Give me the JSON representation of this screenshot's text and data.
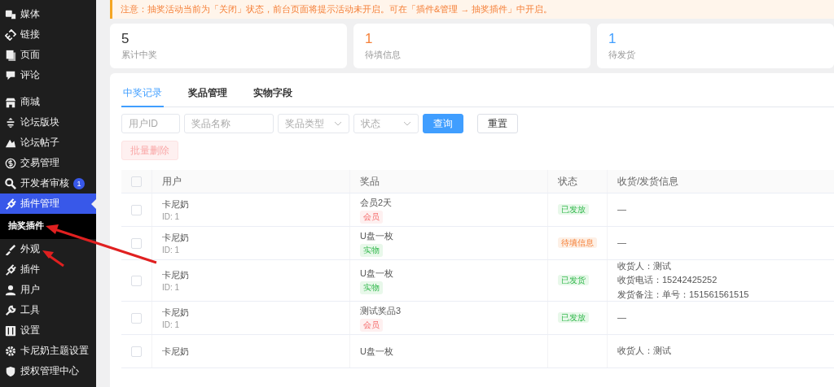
{
  "sidebar": {
    "groups": [
      {
        "items": [
          {
            "label": "媒体",
            "selected": false
          },
          {
            "label": "链接",
            "selected": false
          },
          {
            "label": "页面",
            "selected": false
          },
          {
            "label": "评论",
            "selected": false
          }
        ]
      },
      {
        "items": [
          {
            "label": "商城",
            "selected": false
          },
          {
            "label": "论坛版块",
            "selected": false
          },
          {
            "label": "论坛帖子",
            "selected": false
          },
          {
            "label": "交易管理",
            "selected": false
          },
          {
            "label": "开发者审核",
            "selected": false,
            "badge": "1"
          },
          {
            "label": "插件管理",
            "selected": true,
            "children": [
              {
                "label": "抽奖插件",
                "selected": true
              }
            ]
          },
          {
            "label": "外观",
            "selected": false
          },
          {
            "label": "插件",
            "selected": false
          },
          {
            "label": "用户",
            "selected": false
          },
          {
            "label": "工具",
            "selected": false
          },
          {
            "label": "设置",
            "selected": false
          },
          {
            "label": "卡尼奶主题设置",
            "selected": false
          },
          {
            "label": "授权管理中心",
            "selected": false
          }
        ]
      }
    ]
  },
  "notice": "注意：抽奖活动当前为「关闭」状态，前台页面将提示活动未开启。可在「插件&管理 → 抽奖插件」中开启。",
  "stats": [
    {
      "value": "5",
      "label": "累计中奖",
      "color": "#333333"
    },
    {
      "value": "1",
      "label": "待填信息",
      "color": "#f5813a"
    },
    {
      "value": "1",
      "label": "待发货",
      "color": "#409eff"
    }
  ],
  "tabs": [
    {
      "label": "中奖记录",
      "selected": true
    },
    {
      "label": "奖品管理",
      "selected": false
    },
    {
      "label": "实物字段",
      "selected": false
    }
  ],
  "filters": [
    {
      "kind": "input",
      "placeholder": "用户ID"
    },
    {
      "kind": "input",
      "placeholder": "奖品名称"
    },
    {
      "kind": "select",
      "placeholder": "奖品类型"
    },
    {
      "kind": "select",
      "placeholder": "状态"
    }
  ],
  "buttons": [
    {
      "kind": "primary",
      "label": "查询"
    },
    {
      "kind": "plain",
      "label": "重置"
    }
  ],
  "batch_delete": {
    "label": "批量删除",
    "disabled": true
  },
  "table": {
    "header_checked": false,
    "columns": [
      "用户",
      "奖品",
      "状态",
      "收货/发货信息"
    ],
    "rows": [
      {
        "checked": false,
        "user": "卡尼奶",
        "user_id": "ID: 1",
        "prize": "会员2天",
        "prize_tag": {
          "text": "会员",
          "kind": "member"
        },
        "status": {
          "text": "已发放",
          "kind": "done"
        },
        "info": [
          "—"
        ]
      },
      {
        "checked": false,
        "user": "卡尼奶",
        "user_id": "ID: 1",
        "prize": "U盘一枚",
        "prize_tag": {
          "text": "实物",
          "kind": "physical"
        },
        "status": {
          "text": "待填信息",
          "kind": "pending"
        },
        "info": [
          "—"
        ]
      },
      {
        "checked": false,
        "user": "卡尼奶",
        "user_id": "ID: 1",
        "prize": "U盘一枚",
        "prize_tag": {
          "text": "实物",
          "kind": "physical"
        },
        "status": {
          "text": "已发货",
          "kind": "done"
        },
        "info": [
          "收货人：测试",
          "收货电话：15242425252",
          "发货备注：单号：151561561515"
        ]
      },
      {
        "checked": false,
        "user": "卡尼奶",
        "user_id": "ID: 1",
        "prize": "测试奖品3",
        "prize_tag": {
          "text": "会员",
          "kind": "member"
        },
        "status": {
          "text": "已发放",
          "kind": "done"
        },
        "info": [
          "—"
        ]
      },
      {
        "checked": false,
        "user": "卡尼奶",
        "prize": "U盘一枚",
        "info": [
          "收货人：测试"
        ]
      }
    ]
  }
}
